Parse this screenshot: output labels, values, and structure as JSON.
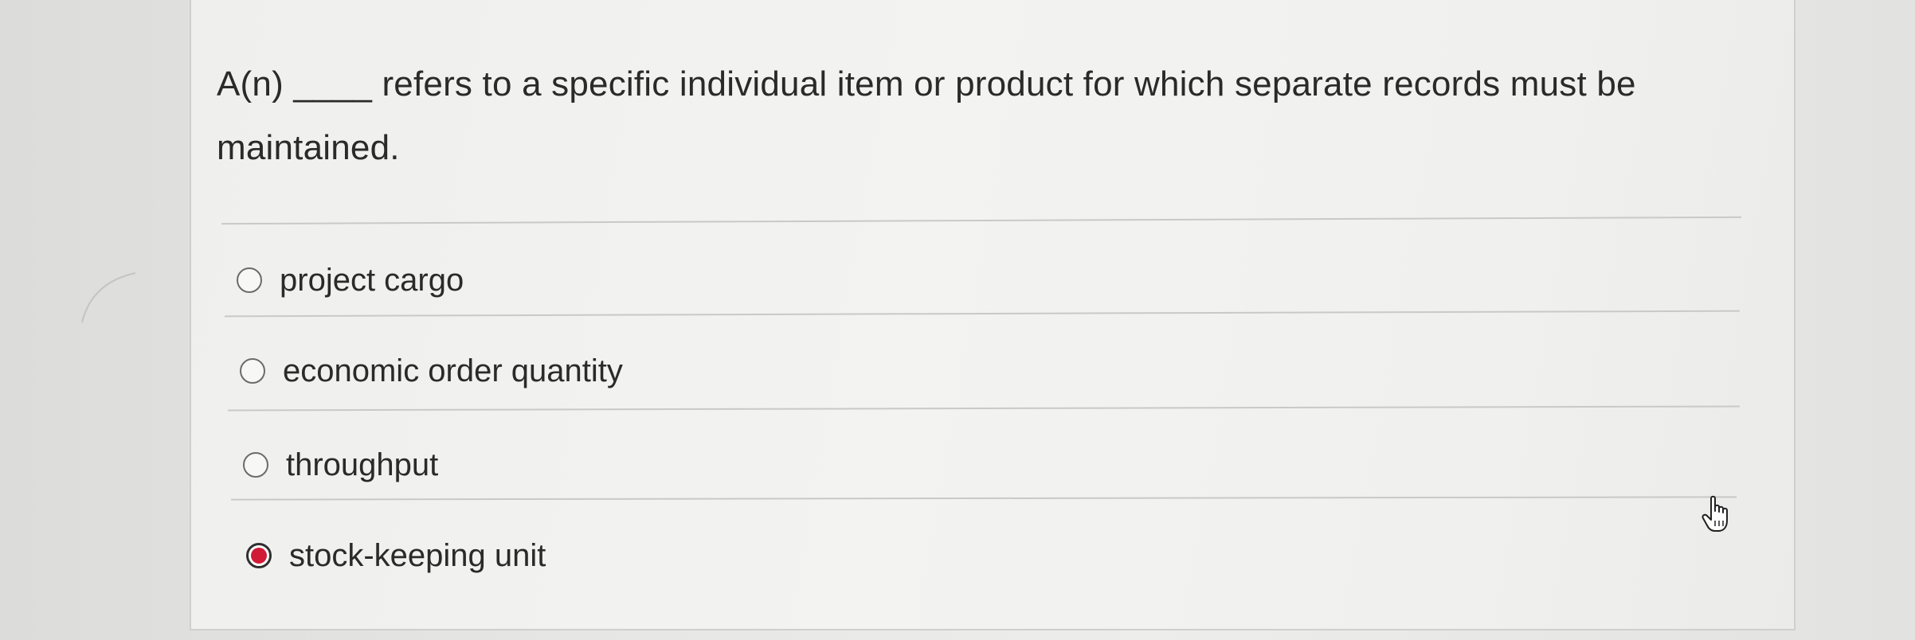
{
  "question": {
    "prompt": "A(n) ____ refers to a specific individual item or product for which separate records must be maintained."
  },
  "options": [
    {
      "label": "project cargo",
      "selected": false
    },
    {
      "label": "economic order quantity",
      "selected": false
    },
    {
      "label": "throughput",
      "selected": false
    },
    {
      "label": "stock-keeping unit",
      "selected": true
    }
  ],
  "colors": {
    "selected_accent": "#d11a36"
  },
  "cursor": {
    "icon": "hand-pointer-icon"
  }
}
